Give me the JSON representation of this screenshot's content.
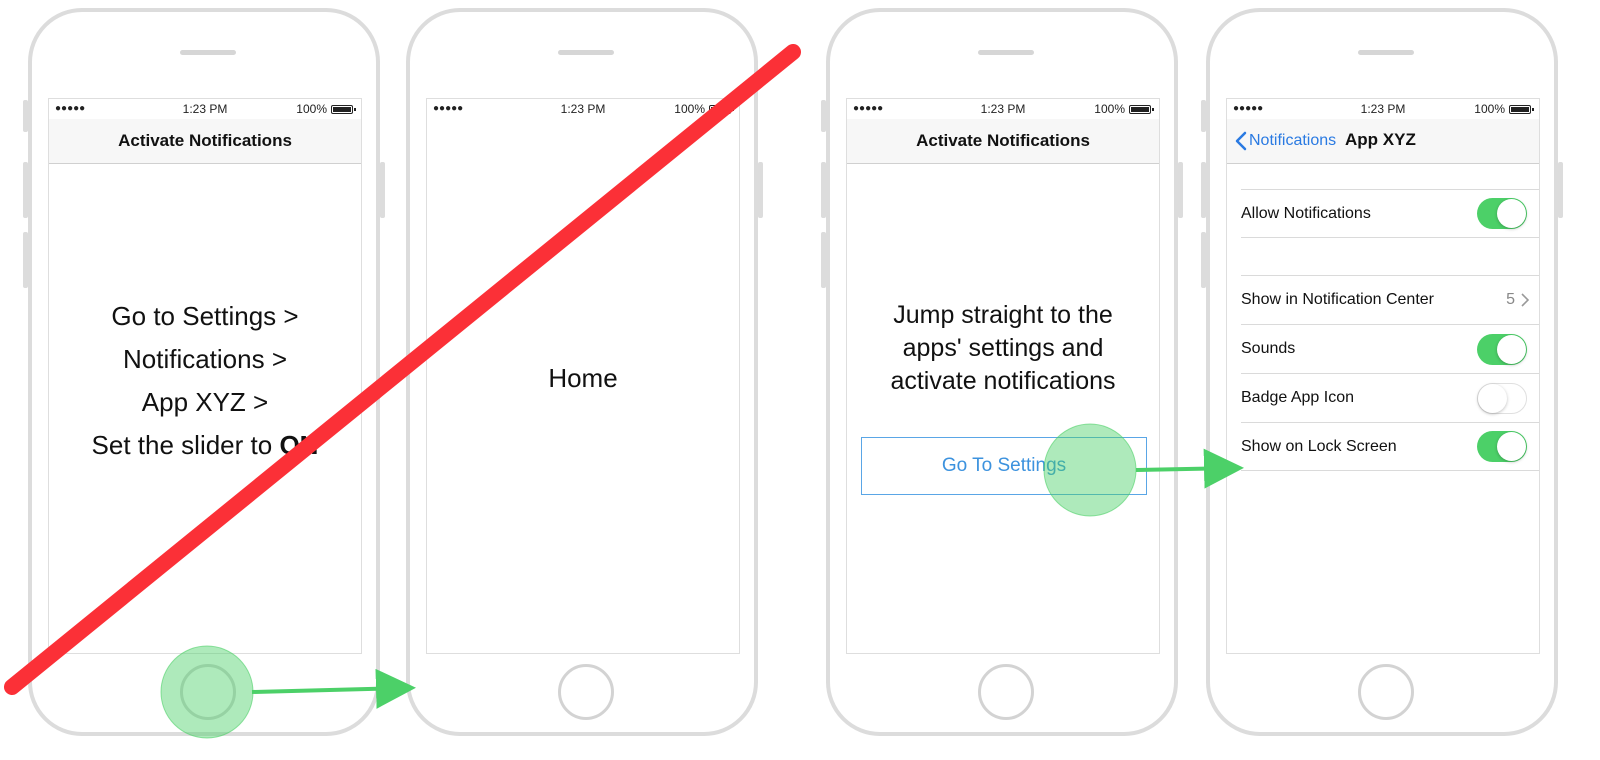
{
  "status_bar": {
    "signal": "●●●●●",
    "time": "1:23 PM",
    "battery": "100%"
  },
  "screen1": {
    "title": "Activate Notifications",
    "lines": [
      "Go to Settings >",
      "Notifications >",
      "App XYZ >"
    ],
    "last_line_prefix": "Set the slider to ",
    "last_line_bold": "ON"
  },
  "screen2": {
    "label": "Home"
  },
  "screen3": {
    "title": "Activate Notifications",
    "lines": [
      "Jump straight to the",
      "apps' settings and",
      "activate notifications"
    ],
    "button_label": "Go To Settings"
  },
  "screen4": {
    "back_label": "Notifications",
    "title": "App XYZ",
    "allow_notifications": {
      "label": "Allow Notifications",
      "on": true
    },
    "rows": [
      {
        "label": "Show in Notification Center",
        "value": "5"
      },
      {
        "label": "Sounds",
        "on": true
      },
      {
        "label": "Badge App Icon",
        "on": false
      },
      {
        "label": "Show on Lock Screen",
        "on": true
      }
    ]
  },
  "colors": {
    "strike": "#fb3037",
    "tap": "#4cd068",
    "link": "#2a7ae2",
    "toggle_on": "#4cd068"
  }
}
